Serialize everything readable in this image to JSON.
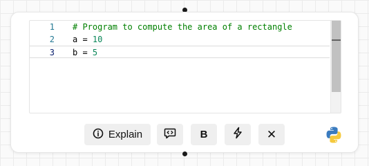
{
  "editor": {
    "lines": [
      {
        "num": "1",
        "text": "# Program to compute the area of a rectangle"
      },
      {
        "num": "2",
        "var": "a",
        "eq": " = ",
        "val": "10"
      },
      {
        "num": "3",
        "var": "b",
        "eq": " = ",
        "val": "5"
      }
    ]
  },
  "toolbar": {
    "explain_label": "Explain",
    "bold_label": "B",
    "close_label": "✕"
  },
  "icons": {
    "explain": "info-circle-icon",
    "comment_code": "comment-code-icon",
    "bolt": "lightning-bolt-icon",
    "close": "close-icon",
    "language": "python-logo"
  },
  "colors": {
    "comment": "#008000",
    "number": "#098658",
    "line_number": "#237893",
    "python_blue": "#3a7bbf",
    "python_yellow": "#f5c93d"
  }
}
